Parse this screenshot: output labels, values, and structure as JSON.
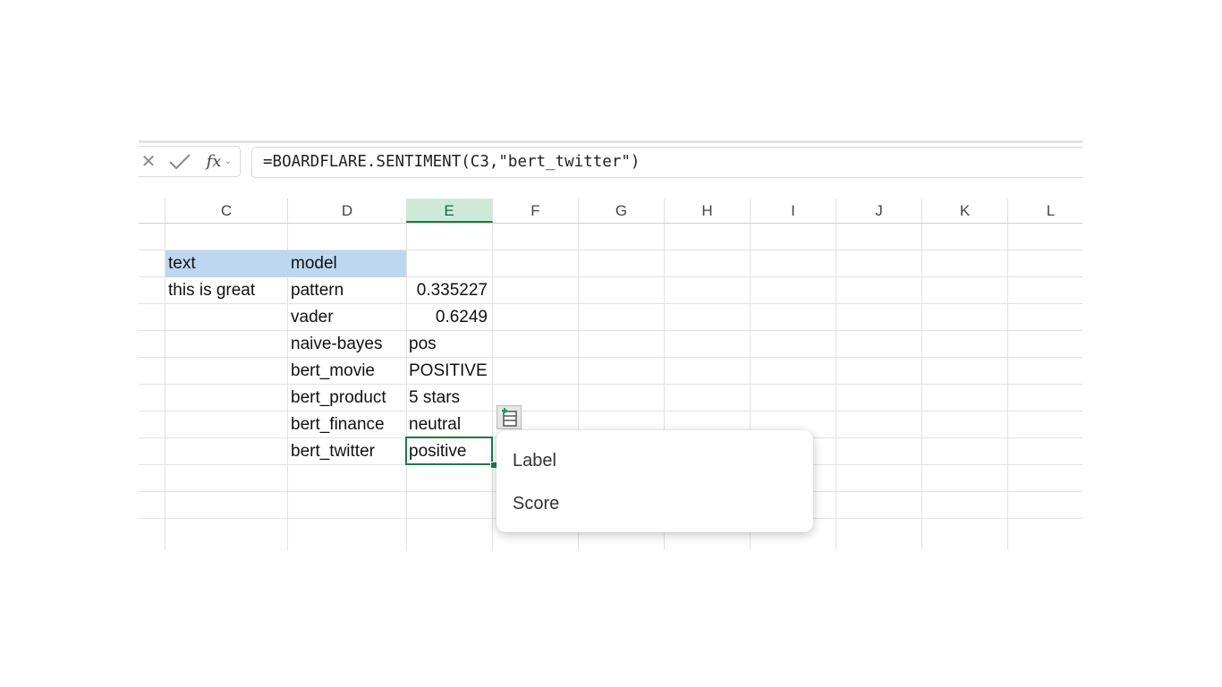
{
  "formula_bar": {
    "fx_label": "fx",
    "formula": "=BOARDFLARE.SENTIMENT(C3,\"bert_twitter\")"
  },
  "columns": [
    "C",
    "D",
    "E",
    "F",
    "G",
    "H",
    "I",
    "J",
    "K",
    "L"
  ],
  "active_column": "E",
  "cells": {
    "header_text": "text",
    "header_model": "model",
    "input_text": "this is great",
    "rows": [
      {
        "model": "pattern",
        "result": "0.335227"
      },
      {
        "model": "vader",
        "result": "0.6249"
      },
      {
        "model": "naive-bayes",
        "result": "pos"
      },
      {
        "model": "bert_movie",
        "result": "POSITIVE"
      },
      {
        "model": "bert_product",
        "result": "5 stars"
      },
      {
        "model": "bert_finance",
        "result": "neutral"
      },
      {
        "model": "bert_twitter",
        "result": "positive"
      }
    ]
  },
  "insert_data_menu": {
    "items": [
      "Label",
      "Score"
    ]
  },
  "colors": {
    "accent": "#1e7a45",
    "header_fill": "#bdd7ee",
    "active_column_fill": "#cfe9d9"
  }
}
